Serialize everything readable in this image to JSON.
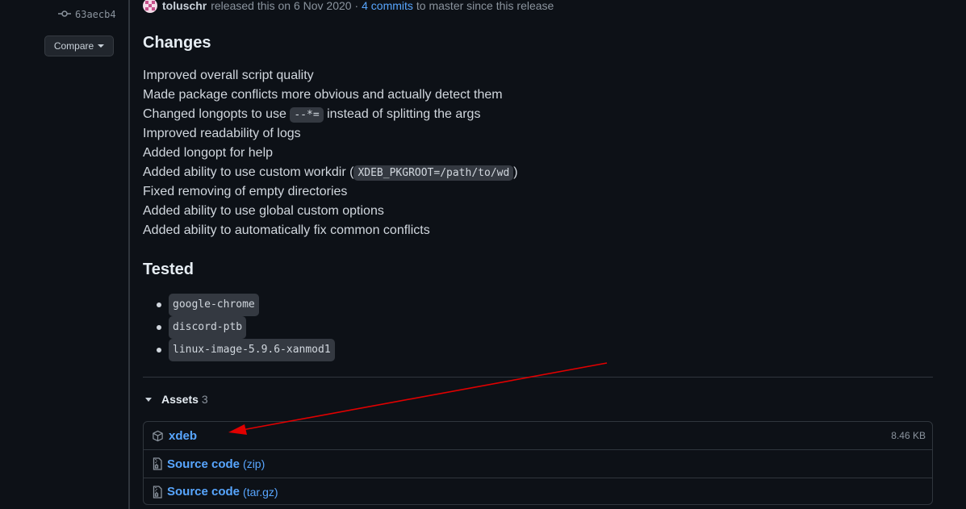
{
  "sidebar": {
    "commit_sha": "63aecb4",
    "compare_label": "Compare"
  },
  "release": {
    "author": "toluschr",
    "released_text": "released this on 6 Nov 2020 ·",
    "commits_link": "4 commits",
    "since_text": "to master since this release"
  },
  "changes": {
    "heading": "Changes",
    "items": [
      {
        "pre": "Improved overall script quality"
      },
      {
        "pre": "Made package conflicts more obvious and actually detect them"
      },
      {
        "pre": "Changed longopts to use ",
        "code": "--*=",
        "post": " instead of splitting the args"
      },
      {
        "pre": "Improved readability of logs"
      },
      {
        "pre": "Added longopt for help"
      },
      {
        "pre": "Added ability to use custom workdir (",
        "code": "XDEB_PKGROOT=/path/to/wd",
        "post": ")"
      },
      {
        "pre": "Fixed removing of empty directories"
      },
      {
        "pre": "Added ability to use global custom options"
      },
      {
        "pre": "Added ability to automatically fix common conflicts"
      }
    ]
  },
  "tested": {
    "heading": "Tested",
    "items": [
      "google-chrome",
      "discord-ptb",
      "linux-image-5.9.6-xanmod1"
    ]
  },
  "assets": {
    "title": "Assets",
    "count": "3",
    "files": [
      {
        "name": "xdeb",
        "suffix": "",
        "size": "8.46 KB",
        "icon": "package-icon"
      },
      {
        "name": "Source code",
        "suffix": "(zip)",
        "size": "",
        "icon": "file-zip-icon"
      },
      {
        "name": "Source code",
        "suffix": "(tar.gz)",
        "size": "",
        "icon": "file-zip-icon"
      }
    ]
  },
  "colors": {
    "background": "#0d1117",
    "link": "#58a6ff",
    "annotation_arrow": "#e00000"
  }
}
